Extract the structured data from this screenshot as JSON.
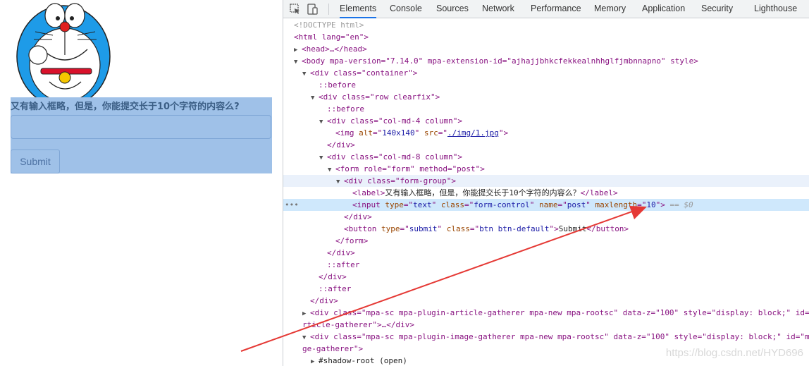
{
  "page": {
    "label": "又有输入框略，但是，你能提交长于10个字符的内容么?",
    "input_value": "",
    "submit_label": "Submit"
  },
  "devtools": {
    "tabs": [
      "Elements",
      "Console",
      "Sources",
      "Network",
      "Performance",
      "Memory",
      "Application",
      "Security",
      "Lighthouse"
    ],
    "active_tab": "Elements",
    "tree": {
      "doctype": "<!DOCTYPE html>",
      "html_open": "<html lang=\"en\">",
      "head": "<head>…</head>",
      "body": "<body mpa-version=\"7.14.0\" mpa-extension-id=\"ajhajjbhkcfekkealnhhglfjmbnnapno\" style>",
      "container": "<div class=\"container\">",
      "before": "::before",
      "row": "<div class=\"row clearfix\">",
      "col4": "<div class=\"col-md-4 column\">",
      "img_alt": "140x140",
      "img_src": "./img/1.jpg",
      "close_div": "</div>",
      "col8": "<div class=\"col-md-8 column\">",
      "form": "<form role=\"form\" method=\"post\">",
      "form_group": "<div class=\"form-group\">",
      "label_text": "又有输入框略，但是，你能提交长于10个字符的内容么？",
      "input_type": "text",
      "input_class": "form-control",
      "input_name": "post",
      "input_maxlength": "10",
      "selected_marker": "== $0",
      "button_text": "Submit",
      "form_close": "</form>",
      "after": "::after",
      "article_gatherer": "<div class=\"mpa-sc mpa-plugin-article-gatherer mpa-new mpa-rootsc\" data-z=\"100\" style=\"display: block;\" id=\"",
      "article_gatherer_cont": "rticle-gatherer\">…</div>",
      "image_gatherer": "<div class=\"mpa-sc mpa-plugin-image-gatherer mpa-new mpa-rootsc\" data-z=\"100\" style=\"display: block;\" id=\"mp",
      "image_gatherer_cont": "ge-gatherer\">",
      "shadow_root": "#shadow-root (open)"
    }
  },
  "watermark": "https://blog.csdn.net/HYD696",
  "colors": {
    "highlight": "#9fc1e8",
    "tag": "#881280",
    "attr_name": "#994500",
    "attr_value": "#1a1aa6",
    "arrow": "#e53935"
  }
}
